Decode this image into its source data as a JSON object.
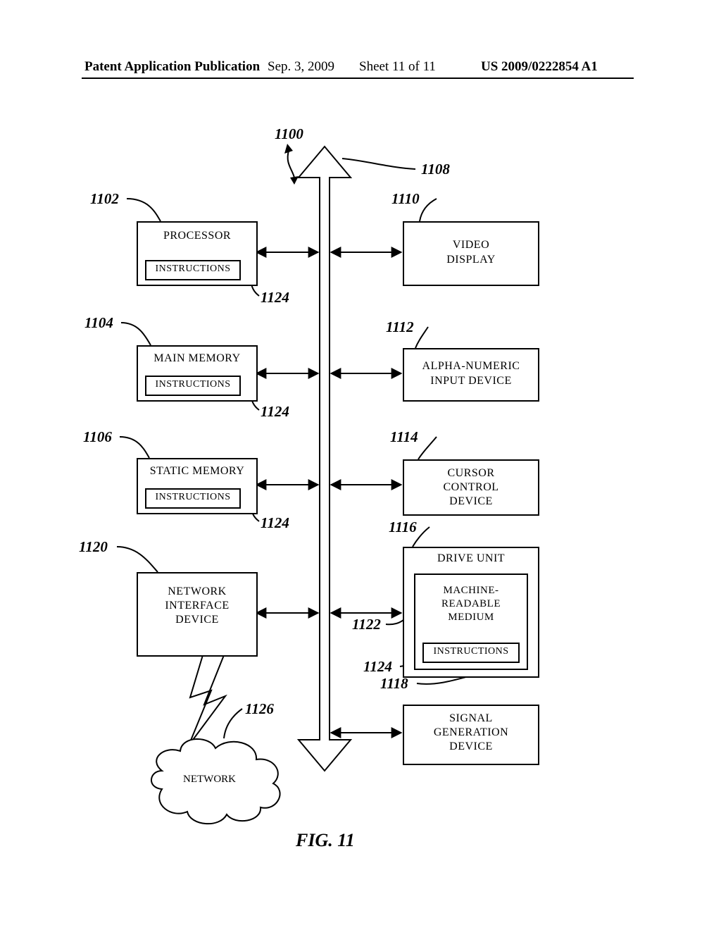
{
  "header": {
    "left": "Patent Application Publication",
    "date": "Sep. 3, 2009",
    "sheet": "Sheet 11 of 11",
    "pubno": "US 2009/0222854 A1"
  },
  "refs": {
    "r1100": "1100",
    "r1102": "1102",
    "r1104": "1104",
    "r1106": "1106",
    "r1108": "1108",
    "r1110": "1110",
    "r1112": "1112",
    "r1114": "1114",
    "r1116": "1116",
    "r1118": "1118",
    "r1120": "1120",
    "r1122": "1122",
    "r1124a": "1124",
    "r1124b": "1124",
    "r1124c": "1124",
    "r1124d": "1124",
    "r1126": "1126"
  },
  "blocks": {
    "processor": "PROCESSOR",
    "mainmem": "MAIN MEMORY",
    "staticmem": "STATIC MEMORY",
    "netif": "NETWORK\nINTERFACE\nDEVICE",
    "video": "VIDEO\nDISPLAY",
    "alnum": "ALPHA-NUMERIC\nINPUT DEVICE",
    "cursor": "CURSOR\nCONTROL\nDEVICE",
    "drive": "DRIVE UNIT",
    "medium": "MACHINE-\nREADABLE\nMEDIUM",
    "signal": "SIGNAL\nGENERATION\nDEVICE",
    "instructions": "INSTRUCTIONS",
    "network": "NETWORK"
  },
  "figcap": "FIG. 11"
}
